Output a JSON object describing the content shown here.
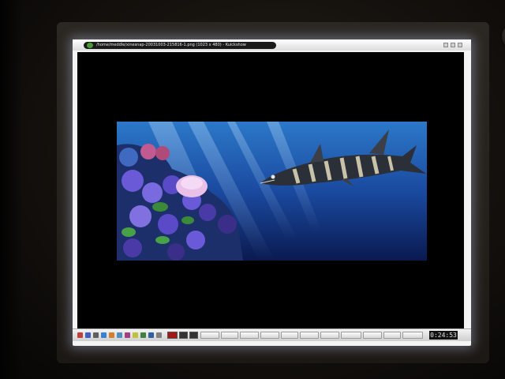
{
  "window": {
    "title": "/home/meddle/xinesnap-20031003-215816-1.png (1023 x 480) - Kuickshow"
  },
  "taskbar": {
    "clock": "0:24:53"
  },
  "scene": {
    "colors": {
      "water_top": "#2c78c8",
      "water_bottom": "#0a1a50",
      "coral_purple": "#6a5ad8",
      "anemone_pink": "#e8c0e8",
      "barracuda_body": "#2a2f38",
      "barracuda_stripe": "#c8c2a8"
    }
  }
}
